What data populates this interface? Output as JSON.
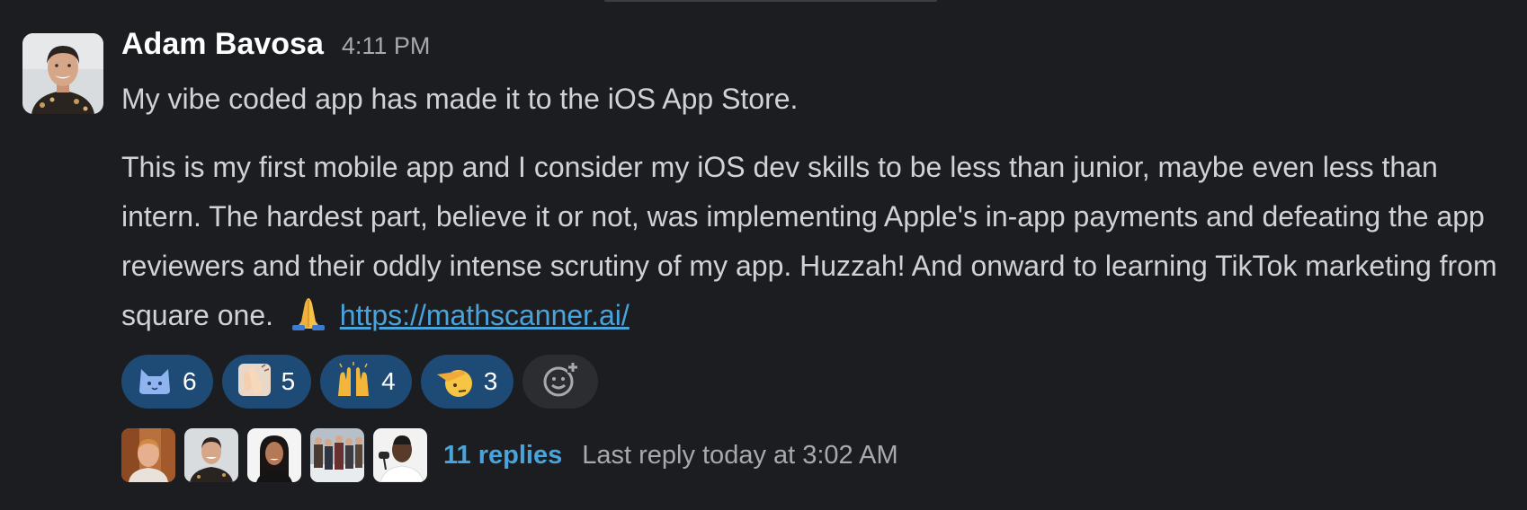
{
  "message": {
    "author": "Adam Bavosa",
    "time": "4:11 PM",
    "line1": "My vibe coded app has made it to the iOS App Store.",
    "paragraph2": "This is my first mobile app and I consider my iOS dev skills to be less than junior, maybe even less than intern. The hardest part, believe it or not, was implementing Apple's in-app payments and defeating the app reviewers and their oddly intense scrutiny of my app. Huzzah! And onward to learning TikTok marketing from square one.",
    "link": "https://mathscanner.ai/",
    "inline_emoji": "folded-hands"
  },
  "reactions": [
    {
      "emoji": "cat-face-blue",
      "count": "6"
    },
    {
      "emoji": "clapping-hands",
      "count": "5"
    },
    {
      "emoji": "raising-hands",
      "count": "4"
    },
    {
      "emoji": "saluting-face",
      "count": "3"
    }
  ],
  "thread": {
    "replies_label": "11 replies",
    "last_reply": "Last reply today at 3:02 AM"
  },
  "colors": {
    "background": "#1b1d21",
    "text": "#d1d2d3",
    "link": "#4aa4dc",
    "reaction_bg": "#1d4b75",
    "muted": "#a8a9ab"
  }
}
